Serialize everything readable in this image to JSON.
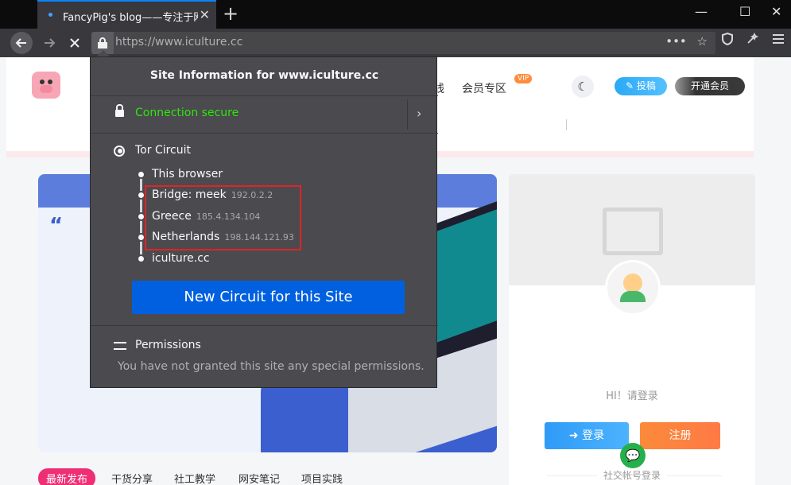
{
  "browser": {
    "tab_title": "FancyPig's blog——专注于网",
    "tab_close": "✕",
    "new_tab": "+",
    "window_controls": [
      "—",
      "☐",
      "✕"
    ],
    "url": "https://www.iculture.cc",
    "nav_icons": [
      "back-icon",
      "forward-icon",
      "stop-icon"
    ]
  },
  "site": {
    "menu_fragment_1": "线",
    "menu_fragment_2": "会员专区",
    "vip_badge": "VIP",
    "contribute_label": "投稿",
    "member_label": "开通会员",
    "greeting": "HI！请登录",
    "login_label": "登录",
    "register_label": "注册",
    "social_login": "社交帐号登录",
    "category_tabs": [
      "最新发布",
      "干货分享",
      "社工教学",
      "网安笔记",
      "项目实践"
    ]
  },
  "popup": {
    "title": "Site Information for www.iculture.cc",
    "connection": "Connection secure",
    "tor_title": "Tor Circuit",
    "circuit": [
      {
        "name": "This browser",
        "ip": ""
      },
      {
        "name": "Bridge: meek",
        "ip": "192.0.2.2"
      },
      {
        "name": "Greece",
        "ip": "185.4.134.104"
      },
      {
        "name": "Netherlands",
        "ip": "198.144.121.93"
      },
      {
        "name": "iculture.cc",
        "ip": ""
      }
    ],
    "new_circuit_label": "New Circuit for this Site",
    "permissions_title": "Permissions",
    "permissions_desc": "You have not granted this site any special permissions."
  },
  "colors": {
    "connection_secure": "#30e60b",
    "new_circuit_button": "#0060df",
    "highlight_box": "#e02424",
    "active_category": "#ef2f74"
  }
}
